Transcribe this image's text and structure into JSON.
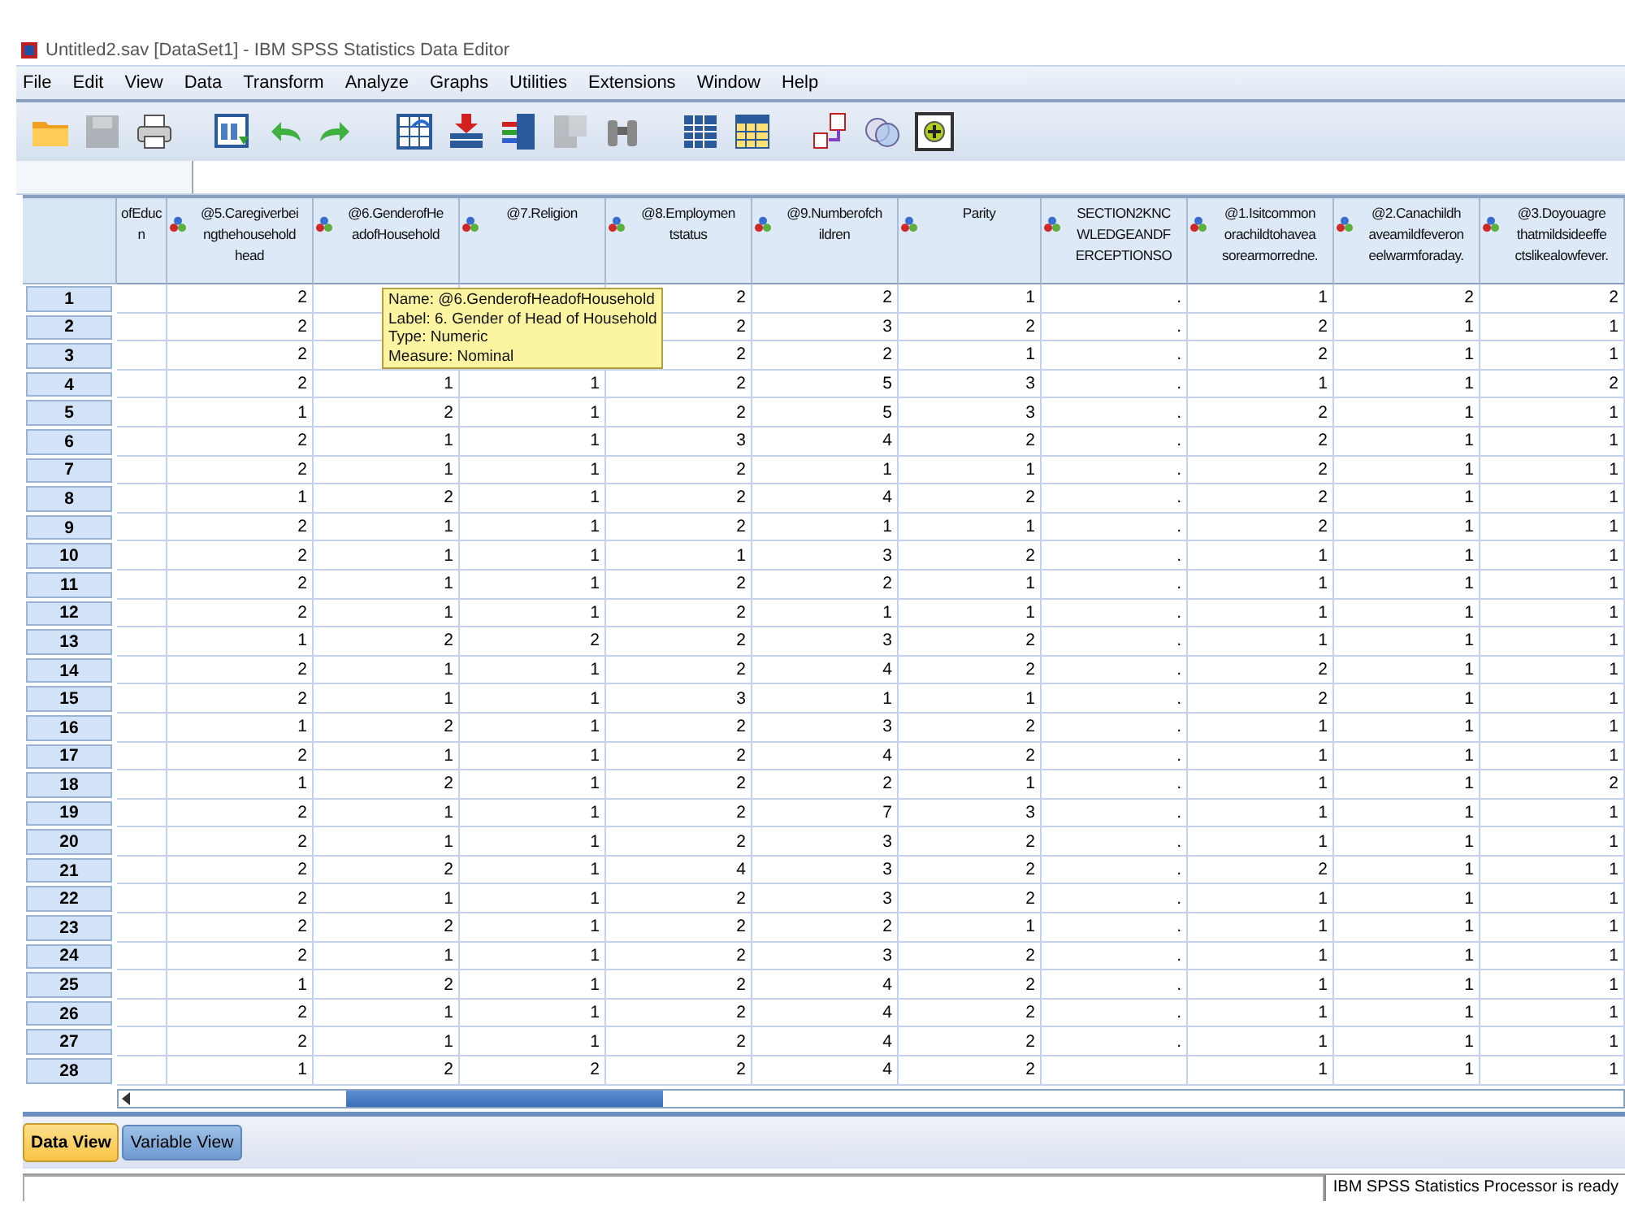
{
  "window": {
    "title": "Untitled2.sav [DataSet1] - IBM SPSS Statistics Data Editor"
  },
  "menu": [
    "File",
    "Edit",
    "View",
    "Data",
    "Transform",
    "Analyze",
    "Graphs",
    "Utilities",
    "Extensions",
    "Window",
    "Help"
  ],
  "toolbar": [
    {
      "kind": "folder",
      "disabled": false
    },
    {
      "kind": "floppy",
      "disabled": true
    },
    {
      "kind": "printer",
      "disabled": false
    },
    {
      "kind": "sep"
    },
    {
      "kind": "dialog",
      "disabled": false
    },
    {
      "kind": "undo",
      "disabled": false
    },
    {
      "kind": "redo",
      "disabled": false
    },
    {
      "kind": "sep"
    },
    {
      "kind": "goto",
      "disabled": false
    },
    {
      "kind": "insert",
      "disabled": false
    },
    {
      "kind": "rows",
      "disabled": false
    },
    {
      "kind": "split",
      "disabled": true
    },
    {
      "kind": "binoculars",
      "disabled": false
    },
    {
      "kind": "sep"
    },
    {
      "kind": "bluegrid",
      "disabled": false
    },
    {
      "kind": "yellowgrid",
      "disabled": false
    },
    {
      "kind": "sep"
    },
    {
      "kind": "labels",
      "disabled": false
    },
    {
      "kind": "circles",
      "disabled": false
    },
    {
      "kind": "plus",
      "disabled": false
    }
  ],
  "columns": [
    {
      "lines": [
        "ofEduc",
        "n"
      ],
      "icon": false
    },
    {
      "lines": [
        "@5.Caregiverbei",
        "ngthehousehold",
        "head"
      ],
      "icon": true
    },
    {
      "lines": [
        "@6.GenderofHe",
        "adofHousehold"
      ],
      "icon": true
    },
    {
      "lines": [
        "@7.Religion"
      ],
      "icon": true
    },
    {
      "lines": [
        "@8.Employmen",
        "tstatus"
      ],
      "icon": true
    },
    {
      "lines": [
        "@9.Numberofch",
        "ildren"
      ],
      "icon": true
    },
    {
      "lines": [
        "Parity"
      ],
      "icon": true
    },
    {
      "lines": [
        "SECTION2KNC",
        "WLEDGEANDF",
        "ERCEPTIONSO"
      ],
      "icon": true
    },
    {
      "lines": [
        "@1.Isitcommon",
        "orachildtohavea",
        "sorearmorredne."
      ],
      "icon": true
    },
    {
      "lines": [
        "@2.Canachildh",
        "aveamildfeveron",
        "eelwarmforaday."
      ],
      "icon": true
    },
    {
      "lines": [
        "@3.Doyouagre",
        "thatmildsideeffe",
        "ctslikealowfever."
      ],
      "icon": true
    }
  ],
  "rows": [
    {
      "num": "1",
      "cells": [
        null,
        "2",
        null,
        null,
        "2",
        "2",
        "1",
        ".",
        "1",
        "2",
        "2"
      ]
    },
    {
      "num": "2",
      "cells": [
        null,
        "2",
        null,
        null,
        "2",
        "3",
        "2",
        ".",
        "2",
        "1",
        "1"
      ]
    },
    {
      "num": "3",
      "cells": [
        null,
        "2",
        null,
        null,
        "2",
        "2",
        "1",
        ".",
        "2",
        "1",
        "1"
      ]
    },
    {
      "num": "4",
      "cells": [
        null,
        "2",
        "1",
        "1",
        "2",
        "5",
        "3",
        ".",
        "1",
        "1",
        "2"
      ]
    },
    {
      "num": "5",
      "cells": [
        null,
        "1",
        "2",
        "1",
        "2",
        "5",
        "3",
        ".",
        "2",
        "1",
        "1"
      ]
    },
    {
      "num": "6",
      "cells": [
        null,
        "2",
        "1",
        "1",
        "3",
        "4",
        "2",
        ".",
        "2",
        "1",
        "1"
      ]
    },
    {
      "num": "7",
      "cells": [
        null,
        "2",
        "1",
        "1",
        "2",
        "1",
        "1",
        ".",
        "2",
        "1",
        "1"
      ]
    },
    {
      "num": "8",
      "cells": [
        null,
        "1",
        "2",
        "1",
        "2",
        "4",
        "2",
        ".",
        "2",
        "1",
        "1"
      ]
    },
    {
      "num": "9",
      "cells": [
        null,
        "2",
        "1",
        "1",
        "2",
        "1",
        "1",
        ".",
        "2",
        "1",
        "1"
      ]
    },
    {
      "num": "10",
      "cells": [
        null,
        "2",
        "1",
        "1",
        "1",
        "3",
        "2",
        ".",
        "1",
        "1",
        "1"
      ]
    },
    {
      "num": "11",
      "cells": [
        null,
        "2",
        "1",
        "1",
        "2",
        "2",
        "1",
        ".",
        "1",
        "1",
        "1"
      ]
    },
    {
      "num": "12",
      "cells": [
        null,
        "2",
        "1",
        "1",
        "2",
        "1",
        "1",
        ".",
        "1",
        "1",
        "1"
      ]
    },
    {
      "num": "13",
      "cells": [
        null,
        "1",
        "2",
        "2",
        "2",
        "3",
        "2",
        ".",
        "1",
        "1",
        "1"
      ]
    },
    {
      "num": "14",
      "cells": [
        null,
        "2",
        "1",
        "1",
        "2",
        "4",
        "2",
        ".",
        "2",
        "1",
        "1"
      ]
    },
    {
      "num": "15",
      "cells": [
        null,
        "2",
        "1",
        "1",
        "3",
        "1",
        "1",
        ".",
        "2",
        "1",
        "1"
      ]
    },
    {
      "num": "16",
      "cells": [
        null,
        "1",
        "2",
        "1",
        "2",
        "3",
        "2",
        ".",
        "1",
        "1",
        "1"
      ]
    },
    {
      "num": "17",
      "cells": [
        null,
        "2",
        "1",
        "1",
        "2",
        "4",
        "2",
        ".",
        "1",
        "1",
        "1"
      ]
    },
    {
      "num": "18",
      "cells": [
        null,
        "1",
        "2",
        "1",
        "2",
        "2",
        "1",
        ".",
        "1",
        "1",
        "2"
      ]
    },
    {
      "num": "19",
      "cells": [
        null,
        "2",
        "1",
        "1",
        "2",
        "7",
        "3",
        ".",
        "1",
        "1",
        "1"
      ]
    },
    {
      "num": "20",
      "cells": [
        null,
        "2",
        "1",
        "1",
        "2",
        "3",
        "2",
        ".",
        "1",
        "1",
        "1"
      ]
    },
    {
      "num": "21",
      "cells": [
        null,
        "2",
        "2",
        "1",
        "4",
        "3",
        "2",
        ".",
        "2",
        "1",
        "1"
      ]
    },
    {
      "num": "22",
      "cells": [
        null,
        "2",
        "1",
        "1",
        "2",
        "3",
        "2",
        ".",
        "1",
        "1",
        "1"
      ]
    },
    {
      "num": "23",
      "cells": [
        null,
        "2",
        "2",
        "1",
        "2",
        "2",
        "1",
        ".",
        "1",
        "1",
        "1"
      ]
    },
    {
      "num": "24",
      "cells": [
        null,
        "2",
        "1",
        "1",
        "2",
        "3",
        "2",
        ".",
        "1",
        "1",
        "1"
      ]
    },
    {
      "num": "25",
      "cells": [
        null,
        "1",
        "2",
        "1",
        "2",
        "4",
        "2",
        ".",
        "1",
        "1",
        "1"
      ]
    },
    {
      "num": "26",
      "cells": [
        null,
        "2",
        "1",
        "1",
        "2",
        "4",
        "2",
        ".",
        "1",
        "1",
        "1"
      ]
    },
    {
      "num": "27",
      "cells": [
        null,
        "2",
        "1",
        "1",
        "2",
        "4",
        "2",
        ".",
        "1",
        "1",
        "1"
      ]
    },
    {
      "num": "28",
      "cells": [
        null,
        "1",
        "2",
        "2",
        "2",
        "4",
        "2",
        null,
        "1",
        "1",
        "1"
      ]
    }
  ],
  "tooltip": [
    "Name: @6.GenderofHeadofHousehold",
    "Label: 6. Gender of Head of Household",
    "Type: Numeric",
    "Measure: Nominal"
  ],
  "tabs": [
    {
      "label": "Data View",
      "selected": true
    },
    {
      "label": "Variable View",
      "selected": false
    }
  ],
  "status_bar": {
    "text": "IBM SPSS Statistics Processor is ready"
  }
}
